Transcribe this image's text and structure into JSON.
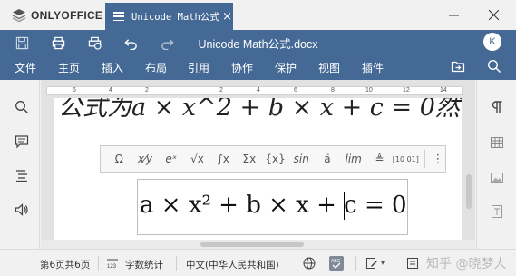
{
  "app": {
    "brand": "ONLYOFFICE",
    "accent": "#446995"
  },
  "tab": {
    "title": "Unicode Math公式.docx",
    "close": "×"
  },
  "window_controls": [
    "minimize-icon",
    "maximize-icon",
    "close-icon"
  ],
  "header": {
    "doc_title": "Unicode Math公式.docx",
    "avatar": "K",
    "quick_access": [
      "save-icon",
      "print-icon",
      "quick-print-icon",
      "undo-icon",
      "redo-icon"
    ],
    "right_icons": [
      "open-location-icon",
      "search-icon"
    ]
  },
  "menu": [
    "文件",
    "主页",
    "插入",
    "布局",
    "引用",
    "协作",
    "保护",
    "视图",
    "插件"
  ],
  "left_panel": [
    "search-icon",
    "comments-icon",
    "navigation-icon",
    "speech-icon"
  ],
  "right_panel": [
    "paragraph-icon",
    "table-icon",
    "image-icon",
    "textbox-icon"
  ],
  "ruler": {
    "numbers": [
      "6",
      "4",
      "2",
      "2",
      "4",
      "6",
      "8",
      "10",
      "12",
      "14"
    ]
  },
  "page": {
    "background_text": "公式为a × x^2 + b × x + c = 0然"
  },
  "equation_toolbar": [
    "Ω",
    "x⁄y",
    "eˣ",
    "√x",
    "∫x",
    "Σx",
    "{x}",
    "sin",
    "ä",
    "lim",
    "≜",
    "[10 01]",
    "⋮"
  ],
  "equation": {
    "content": "a × x² + b × x + c = 0"
  },
  "status": {
    "page_info": "第6页共6页",
    "word_count": "字数统计",
    "language": "中文(中华人民共和国)",
    "icons": [
      "word-count-icon",
      "globe-icon",
      "spellcheck-icon",
      "track-changes-icon",
      "doc-language-icon"
    ]
  },
  "watermark": "知乎 @晓梦大"
}
